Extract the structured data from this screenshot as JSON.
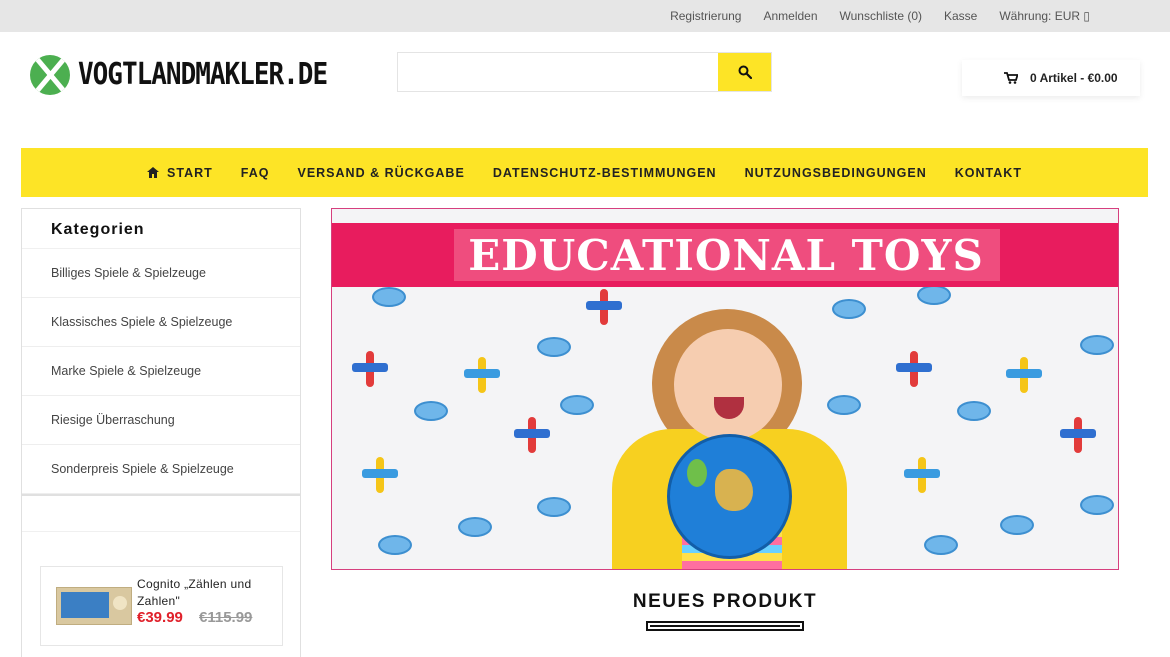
{
  "topbar": {
    "links": [
      "Registrierung",
      "Anmelden",
      "Wunschliste (0)",
      "Kasse"
    ],
    "currency": "Währung: EUR ▯"
  },
  "header": {
    "logo_text": "VOGTLANDMAKLER.DE",
    "search": {
      "placeholder": "",
      "value": "",
      "icon": "search-icon"
    },
    "cart": {
      "label": "0 Artikel - €0.00",
      "icon": "cart-icon"
    }
  },
  "nav": {
    "items": [
      {
        "label": "START",
        "icon": "home-icon"
      },
      {
        "label": "FAQ"
      },
      {
        "label": "VERSAND & RÜCKGABE"
      },
      {
        "label": "DATENSCHUTZ-BESTIMMUNGEN"
      },
      {
        "label": "NUTZUNGSBEDINGUNGEN"
      },
      {
        "label": "KONTAKT"
      }
    ]
  },
  "sidebar": {
    "title": "Kategorien",
    "items": [
      "Billiges Spiele & Spielzeuge",
      "Klassisches Spiele & Spielzeuge",
      "Marke Spiele & Spielzeuge",
      "Riesige Überraschung",
      "Sonderpreis Spiele & Spielzeuge"
    ],
    "product": {
      "name": "Cognito „Zählen und Zahlen\"",
      "price": "€39.99",
      "old_price": "€115.99"
    }
  },
  "banner": {
    "title": "EDUCATIONAL TOYS"
  },
  "section": {
    "title": "NEUES PRODUKT"
  },
  "colors": {
    "accent": "#fde426",
    "banner_strip": "#e81c5e",
    "price": "#e0202a"
  }
}
